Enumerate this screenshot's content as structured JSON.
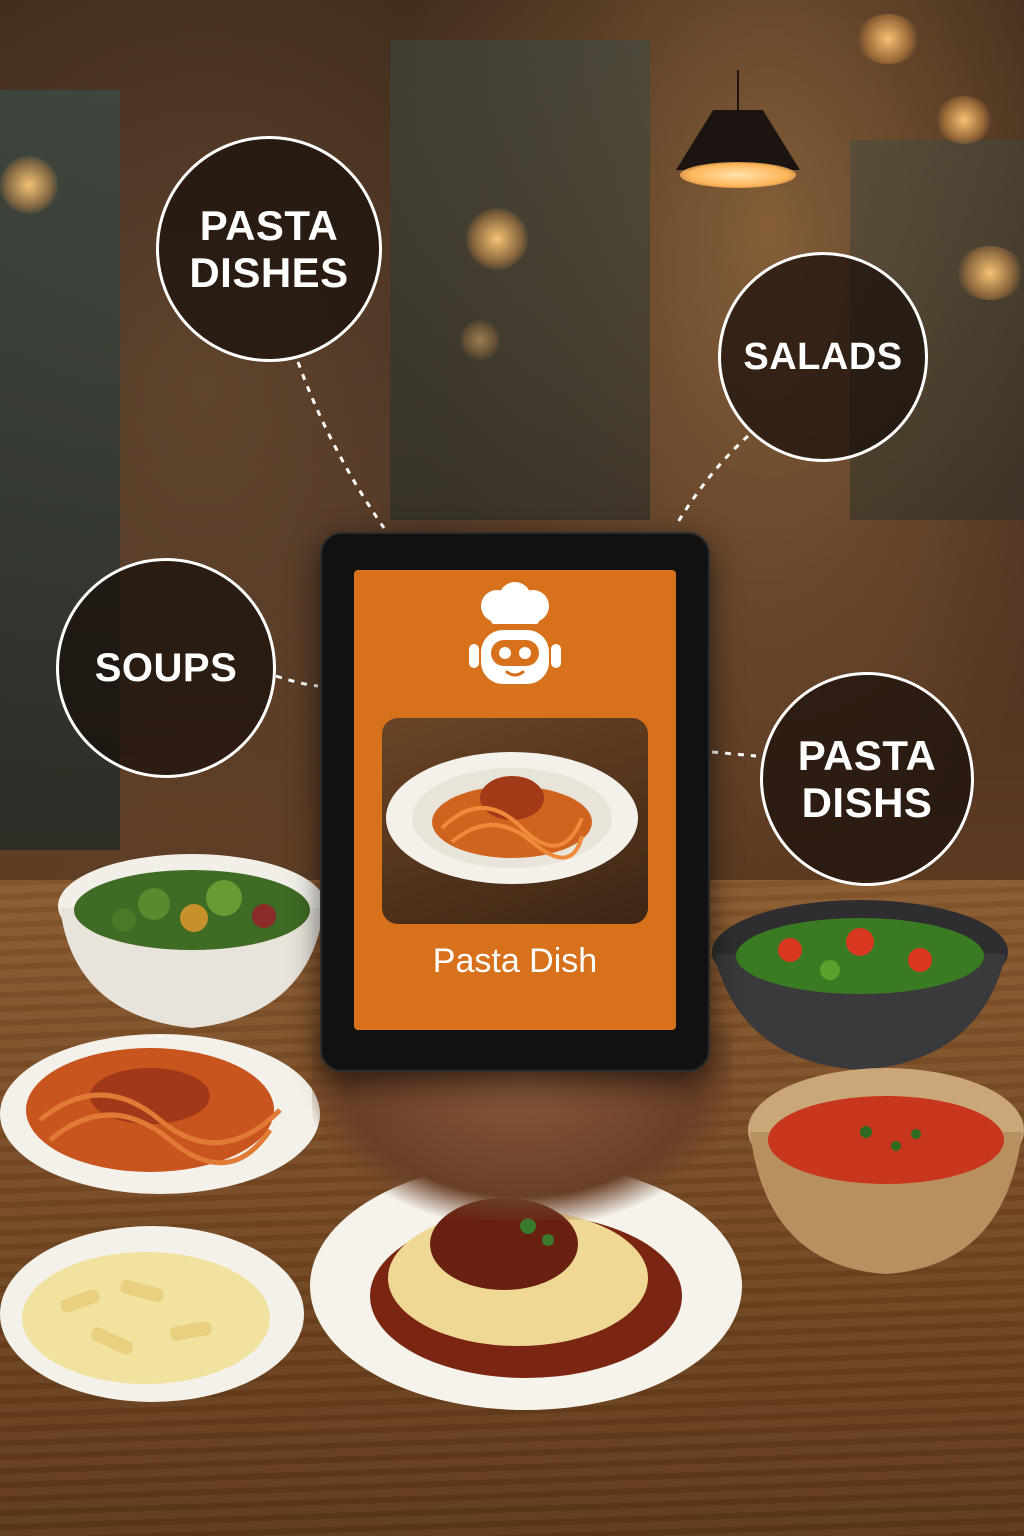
{
  "bubbles": {
    "top_left": "PASTA\nDISHES",
    "top_right": "SALADS",
    "mid_left": "SOUPS",
    "mid_right": "PASTA\nDISHS"
  },
  "tablet": {
    "icon": "chef-robot-icon",
    "dish_label": "Pasta Dish"
  },
  "colors": {
    "screen_orange": "#d7711c",
    "bubble_border": "#ffffff"
  }
}
